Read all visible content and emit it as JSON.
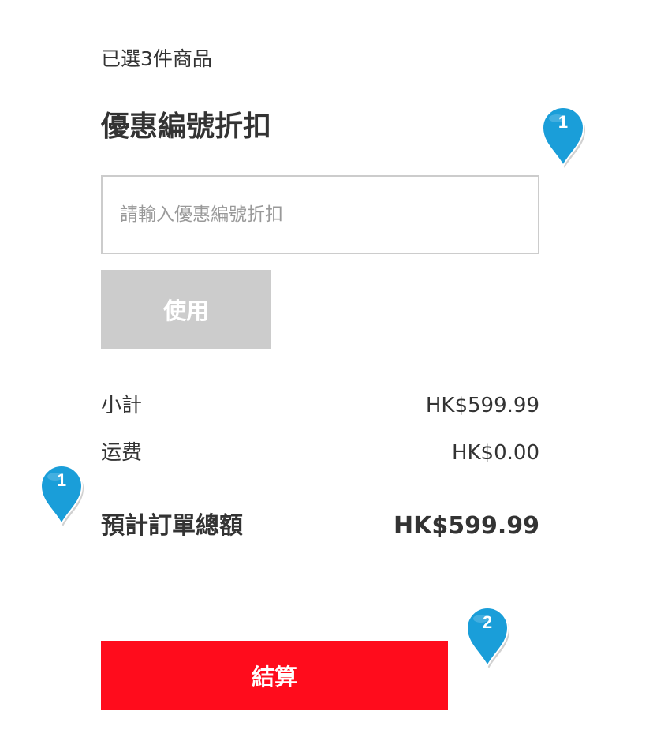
{
  "cart": {
    "selected_count": "已選3件商品"
  },
  "coupon": {
    "heading": "優惠編號折扣",
    "placeholder": "請輸入優惠編號折扣",
    "value": "",
    "apply_label": "使用"
  },
  "summary": {
    "subtotal_label": "小計",
    "subtotal_value": "HK$599.99",
    "shipping_label": "运费",
    "shipping_value": "HK$0.00",
    "total_label": "預計訂單總額",
    "total_value": "HK$599.99"
  },
  "checkout": {
    "label": "結算"
  },
  "markers": [
    {
      "number": "1"
    },
    {
      "number": "1"
    },
    {
      "number": "2"
    }
  ],
  "colors": {
    "checkout_bg": "#ff0c1c",
    "apply_bg": "#cccccc",
    "marker_bg": "#1a9ed9",
    "text": "#333333"
  }
}
